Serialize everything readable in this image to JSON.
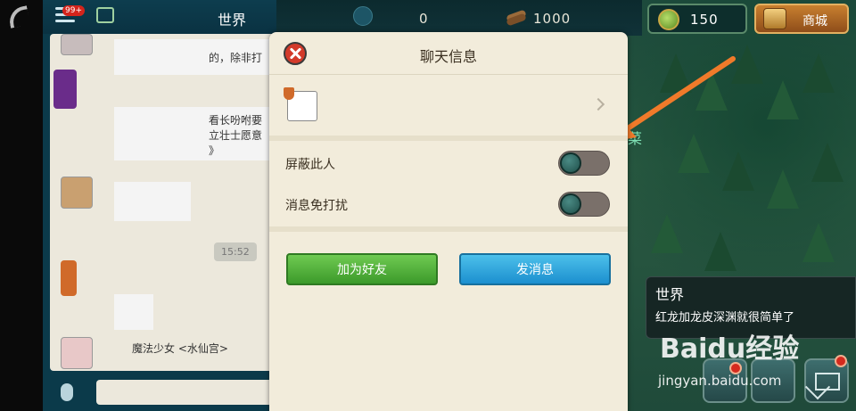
{
  "chat_panel": {
    "header_title": "世界",
    "unread_badge": "99+",
    "time_tag": "15:52",
    "snippets": [
      "的，除非打",
      "看长吩咐要",
      "立壮士愿意",
      "》",
      "魔法少女 <水仙宫>"
    ]
  },
  "resources": {
    "unknown_value": "0",
    "wood": "1000",
    "gems": "150",
    "shop_label": "商城"
  },
  "dialog": {
    "title": "聊天信息",
    "settings": [
      {
        "label": "屏蔽此人",
        "enabled": false
      },
      {
        "label": "消息免打扰",
        "enabled": false
      }
    ],
    "add_friend_label": "加为好友",
    "send_message_label": "发消息"
  },
  "world_box": {
    "title": "世界",
    "message": "红龙加龙皮深渊就很简单了"
  },
  "map_label": "菜",
  "watermark": {
    "text": "Baidu经验",
    "url": "jingyan.baidu.com"
  },
  "colors": {
    "accent_green": "#4fae36",
    "accent_blue": "#2aa3dc",
    "arrow_orange": "#f07a2a",
    "dialog_bg": "#f2ecdb"
  }
}
